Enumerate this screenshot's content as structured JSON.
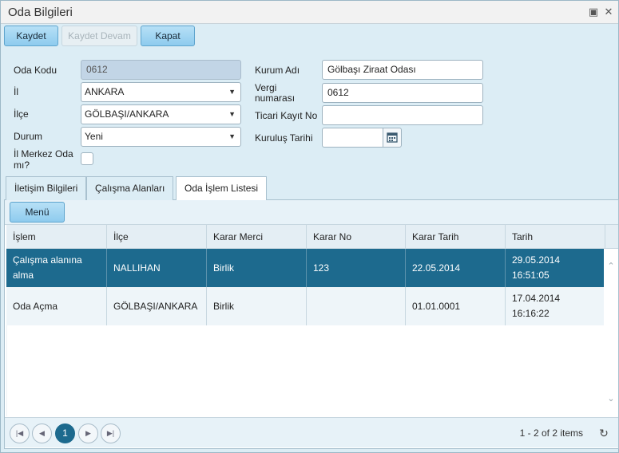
{
  "window": {
    "title": "Oda Bilgileri"
  },
  "toolbar": {
    "save": "Kaydet",
    "save_continue": "Kaydet Devam",
    "close": "Kapat"
  },
  "form": {
    "oda_kodu": {
      "label": "Oda Kodu",
      "value": "0612"
    },
    "il": {
      "label": "İl",
      "value": "ANKARA"
    },
    "ilce": {
      "label": "İlçe",
      "value": "GÖLBAŞI/ANKARA"
    },
    "durum": {
      "label": "Durum",
      "value": "Yeni"
    },
    "il_merkez": {
      "label_line1": "İl Merkez Oda",
      "label_line2": "mı?"
    },
    "kurum_adi": {
      "label": "Kurum Adı",
      "value": "Gölbaşı Ziraat Odası"
    },
    "vergi": {
      "label_line1": "Vergi",
      "label_line2": "numarası",
      "value": "0612"
    },
    "ticari": {
      "label": "Ticari Kayıt No",
      "value": ""
    },
    "kurulus": {
      "label": "Kuruluş Tarihi",
      "value": ""
    }
  },
  "tabs": [
    {
      "label": "İletişim Bilgileri"
    },
    {
      "label": "Çalışma Alanları"
    },
    {
      "label": "Oda İşlem Listesi"
    }
  ],
  "grid": {
    "menu": "Menü",
    "columns": [
      "İşlem",
      "İlçe",
      "Karar Merci",
      "Karar No",
      "Karar Tarih",
      "Tarih"
    ],
    "rows": [
      {
        "islem_line1": "Çalışma alanına",
        "islem_line2": "alma",
        "ilce": "NALLIHAN",
        "karar_merci": "Birlik",
        "karar_no": "123",
        "karar_tarih": "22.05.2014",
        "tarih_line1": "29.05.2014",
        "tarih_line2": "16:51:05"
      },
      {
        "islem_line1": "Oda Açma",
        "islem_line2": "",
        "ilce": "GÖLBAŞI/ANKARA",
        "karar_merci": "Birlik",
        "karar_no": "",
        "karar_tarih": "01.01.0001",
        "tarih_line1": "17.04.2014",
        "tarih_line2": "16:16:22"
      }
    ]
  },
  "pager": {
    "current_page": "1",
    "info": "1 - 2 of 2 items"
  },
  "icons": {
    "maximize": "maximize-icon",
    "close": "close-icon",
    "dropdown": "chevron-down-icon",
    "calendar": "calendar-icon",
    "first": "first-page-icon",
    "prev": "prev-page-icon",
    "next": "next-page-icon",
    "last": "last-page-icon",
    "refresh": "refresh-icon",
    "scroll_up": "scroll-up-icon",
    "scroll_down": "scroll-down-icon"
  },
  "colors": {
    "accent": "#1d6a8e",
    "button": "#8ecbee",
    "background": "#dcedf5"
  }
}
